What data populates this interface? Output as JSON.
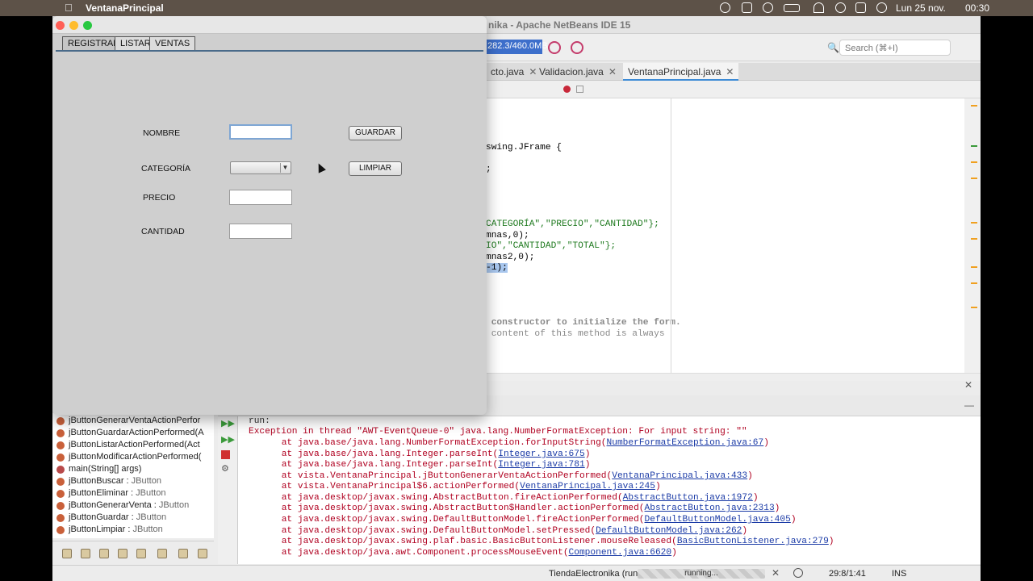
{
  "menubar": {
    "app_name": "VentanaPrincipal",
    "date": "Lun 25 nov.",
    "time": "00:30"
  },
  "ide": {
    "title_fragment": "nika - Apache NetBeans IDE 15",
    "memory": "282.3/460.0MB",
    "search_placeholder": "Search (⌘+I)",
    "tabs": [
      {
        "label": "cto.java"
      },
      {
        "label": "Validacion.java"
      },
      {
        "label": "VentanaPrincipal.java",
        "active": true
      }
    ],
    "code_lines": [
      {
        "text": "swing.JFrame {",
        "kind": "code"
      },
      {
        "text": ";",
        "kind": "code"
      },
      {
        "text": "CATEGORÍA\",\"PRECIO\",\"CANTIDAD\"};",
        "kind": "code"
      },
      {
        "text": "mnas,0);",
        "kind": "code"
      },
      {
        "text": "IO\",\"CANTIDAD\",\"TOTAL\"};",
        "kind": "code"
      },
      {
        "text": "mnas2,0);",
        "kind": "code"
      },
      {
        "text": "-1);",
        "kind": "selected"
      },
      {
        "text": " constructor to initialize the form.",
        "kind": "comment"
      },
      {
        "text": " content of this method is always",
        "kind": "comment"
      }
    ]
  },
  "output": {
    "lines": [
      {
        "prefix": "run:",
        "link": "",
        "suffix": "",
        "kind": "plain"
      },
      {
        "prefix": "Exception in thread \"AWT-EventQueue-0\" java.lang.NumberFormatException: For input string: \"\"",
        "link": "",
        "suffix": "",
        "kind": "error"
      },
      {
        "prefix": "        at java.base/java.lang.NumberFormatException.forInputString(",
        "link": "NumberFormatException.java:67",
        "suffix": ")",
        "kind": "error"
      },
      {
        "prefix": "        at java.base/java.lang.Integer.parseInt(",
        "link": "Integer.java:675",
        "suffix": ")",
        "kind": "error"
      },
      {
        "prefix": "        at java.base/java.lang.Integer.parseInt(",
        "link": "Integer.java:781",
        "suffix": ")",
        "kind": "error"
      },
      {
        "prefix": "        at vista.VentanaPrincipal.jButtonGenerarVentaActionPerformed(",
        "link": "VentanaPrincipal.java:433",
        "suffix": ")",
        "kind": "error"
      },
      {
        "prefix": "        at vista.VentanaPrincipal$6.actionPerformed(",
        "link": "VentanaPrincipal.java:245",
        "suffix": ")",
        "kind": "error"
      },
      {
        "prefix": "        at java.desktop/javax.swing.AbstractButton.fireActionPerformed(",
        "link": "AbstractButton.java:1972",
        "suffix": ")",
        "kind": "error"
      },
      {
        "prefix": "        at java.desktop/javax.swing.AbstractButton$Handler.actionPerformed(",
        "link": "AbstractButton.java:2313",
        "suffix": ")",
        "kind": "error"
      },
      {
        "prefix": "        at java.desktop/javax.swing.DefaultButtonModel.fireActionPerformed(",
        "link": "DefaultButtonModel.java:405",
        "suffix": ")",
        "kind": "error"
      },
      {
        "prefix": "        at java.desktop/javax.swing.DefaultButtonModel.setPressed(",
        "link": "DefaultButtonModel.java:262",
        "suffix": ")",
        "kind": "error"
      },
      {
        "prefix": "        at java.desktop/javax.swing.plaf.basic.BasicButtonListener.mouseReleased(",
        "link": "BasicButtonListener.java:279",
        "suffix": ")",
        "kind": "error"
      },
      {
        "prefix": "        at java.desktop/java.awt.Component.processMouseEvent(",
        "link": "Component.java:6620",
        "suffix": ")",
        "kind": "error"
      }
    ]
  },
  "navigator": {
    "items": [
      {
        "name": "jButtonGenerarVentaActionPerfor",
        "type": ""
      },
      {
        "name": "jButtonGuardarActionPerformed(A",
        "type": ""
      },
      {
        "name": "jButtonListarActionPerformed(Act",
        "type": ""
      },
      {
        "name": "jButtonModificarActionPerformed(",
        "type": ""
      },
      {
        "name": "main(String[] args)",
        "type": ""
      },
      {
        "name": "jButtonBuscar : ",
        "type": "JButton"
      },
      {
        "name": "jButtonEliminar : ",
        "type": "JButton"
      },
      {
        "name": "jButtonGenerarVenta : ",
        "type": "JButton"
      },
      {
        "name": "jButtonGuardar : ",
        "type": "JButton"
      },
      {
        "name": "jButtonLimpiar : ",
        "type": "JButton"
      }
    ]
  },
  "status": {
    "project": "TiendaElectronika (run)",
    "progress_text": "running...",
    "position": "29:8/1:41",
    "mode": "INS"
  },
  "jframe": {
    "tabs": [
      "REGISTRAR",
      "LISTAR",
      "VENTAS"
    ],
    "selected_tab": "REGISTRAR",
    "labels": {
      "nombre": "NOMBRE",
      "categoria": "CATEGORÍA",
      "precio": "PRECIO",
      "cantidad": "CANTIDAD"
    },
    "fields": {
      "nombre": "",
      "categoria": "",
      "precio": "",
      "cantidad": ""
    },
    "buttons": {
      "guardar": "GUARDAR",
      "limpiar": "LIMPIAR"
    }
  },
  "colors": {
    "accent": "#3d8bd6",
    "error_text": "#b00020",
    "link": "#1a3aa6"
  }
}
